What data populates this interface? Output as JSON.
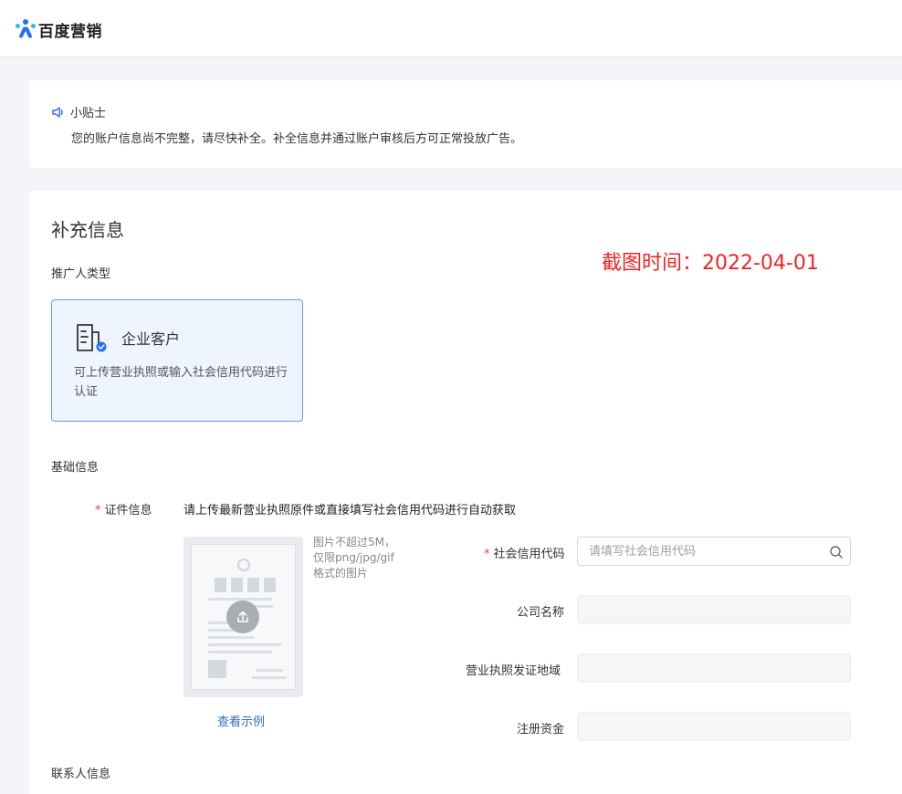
{
  "header": {
    "logo_text": "百度营销"
  },
  "tips": {
    "title": "小贴士",
    "text": "您的账户信息尚不完整，请尽快补全。补全信息并通过账户审核后方可正常投放广告。"
  },
  "form": {
    "section_title": "补充信息",
    "screenshot_time": "截图时间：2022-04-01",
    "promoter_type_label": "推广人类型",
    "promoter_type": {
      "name": "企业客户",
      "description": "可上传营业执照或输入社会信用代码进行认证"
    },
    "basic_info_label": "基础信息",
    "cert_label": "证件信息",
    "cert_hint": "请上传最新营业执照原件或直接填写社会信用代码进行自动获取",
    "upload_note": "图片不超过5M，仅限png/jpg/gif格式的图片",
    "example_link": "查看示例",
    "credit_code_label": "社会信用代码",
    "credit_code_placeholder": "请填写社会信用代码",
    "credit_code_value": "",
    "company_name_label": "公司名称",
    "company_name_value": "",
    "license_region_label": "营业执照发证地域",
    "license_region_value": "",
    "registered_capital_label": "注册资金",
    "registered_capital_value": "",
    "contact_info_label": "联系人信息",
    "required_mark": "*"
  },
  "colors": {
    "brand": "#2a6df5",
    "selected_card_bg": "#eef5ff",
    "selected_card_border": "#5b9bf2",
    "required": "#e8403f",
    "link": "#2f6cc8",
    "annotation_red": "#f02424"
  },
  "icons": {
    "logo": "baidu-marketing-logo",
    "tips": "speaker-icon",
    "enterprise": "enterprise-document-icon",
    "upload": "upload-arrow-icon",
    "search": "search-icon"
  }
}
